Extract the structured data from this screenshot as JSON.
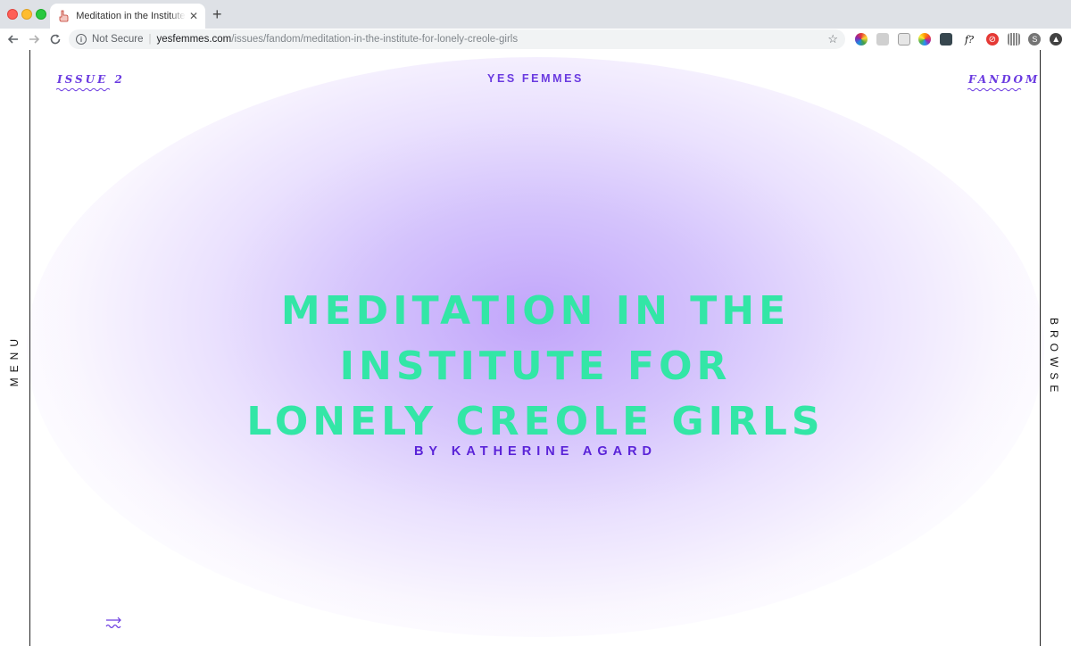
{
  "browser": {
    "tab_title": "Meditation in the Institute for Lonely Creole Girls",
    "tab_close": "✕",
    "new_tab": "+",
    "security_label": "Not Secure",
    "url_host": "yesfemmes.com",
    "url_path": "/issues/fandom/meditation-in-the-institute-for-lonely-creole-girls",
    "extensions": [
      {
        "icon": "color-wheel-icon",
        "color": "#e53935"
      },
      {
        "icon": "gray-extension-icon",
        "color": "#bdbdbd"
      },
      {
        "icon": "screenshot-extension-icon",
        "color": "#9e9e9e"
      },
      {
        "icon": "colorful-flower-icon",
        "color": "#ff9800"
      },
      {
        "icon": "cube-icon",
        "color": "#37474f"
      },
      {
        "icon": "font-question-icon",
        "color": "#111111",
        "text": "f?"
      },
      {
        "icon": "red-block-icon",
        "color": "#e53935"
      },
      {
        "icon": "barcode-icon",
        "color": "#9e9e9e"
      },
      {
        "icon": "profile-avatar-icon",
        "color": "#757575",
        "text": "S"
      },
      {
        "icon": "upload-circle-icon",
        "color": "#424242"
      }
    ]
  },
  "page": {
    "brand": "YES FEMMES",
    "issue": "ISSUE 2",
    "section": "FANDOM",
    "menu": "MENU",
    "browse": "BROWSE",
    "title_lines": [
      "MEDITATION IN THE",
      "INSTITUTE FOR",
      "LONELY CREOLE GIRLS"
    ],
    "byline": "BY KATHERINE AGARD",
    "colors": {
      "accent": "#6a3ae0",
      "title": "#33e6a6",
      "byline": "#5a23d8",
      "glow": "#bea0fa"
    }
  }
}
